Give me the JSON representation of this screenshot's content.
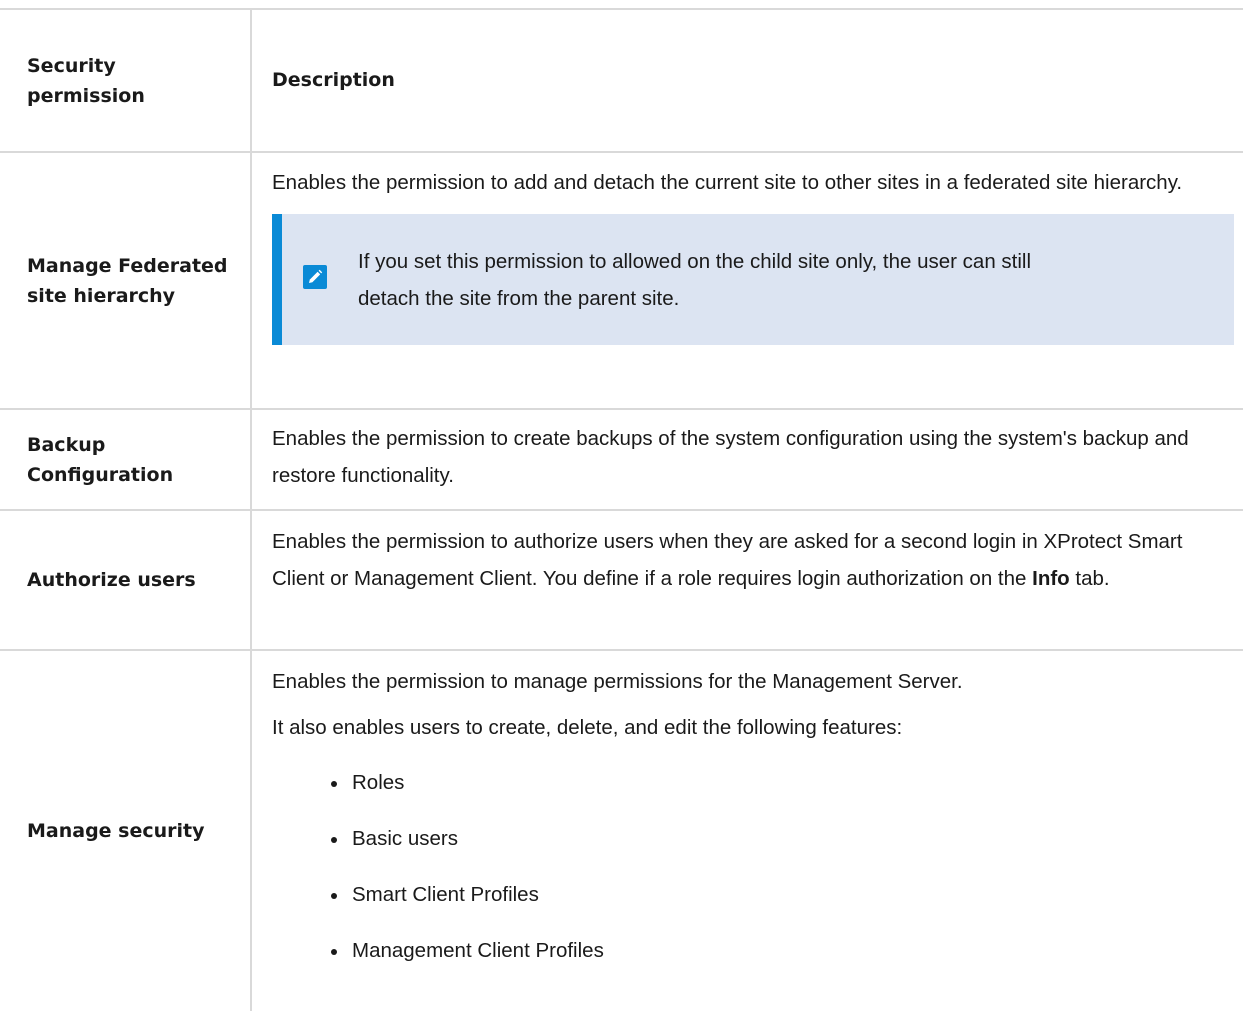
{
  "header": {
    "col1": "Security permission",
    "col2": "Description"
  },
  "rows": [
    {
      "name": "Manage Federated site hierarchy",
      "desc": "Enables the permission to add and detach the current site to other sites in a federated site hierarchy.",
      "note": "If you set this permission to allowed on the child site only, the user can still detach the site from the parent site.",
      "note_icon": "pencil-note-icon"
    },
    {
      "name": "Backup Configuration",
      "desc": "Enables the permission to create backups of the system configuration using the system's backup and restore functionality."
    },
    {
      "name": "Authorize users",
      "desc_before": "Enables the permission to authorize users when they are asked for a second login in XProtect Smart Client or Management Client. You define if a role requires login authorization on the ",
      "desc_bold": "Info",
      "desc_after": " tab."
    },
    {
      "name": "Manage security",
      "desc": "Enables the permission to manage permissions for the Management Server.",
      "desc2": "It also enables users to create, delete, and edit the following features:",
      "bullets": [
        "Roles",
        "Basic users",
        "Smart Client Profiles",
        "Management Client Profiles"
      ]
    }
  ],
  "colors": {
    "note_bg": "#dce4f2",
    "note_accent": "#0a8ad6",
    "border": "#d9d9d9"
  }
}
